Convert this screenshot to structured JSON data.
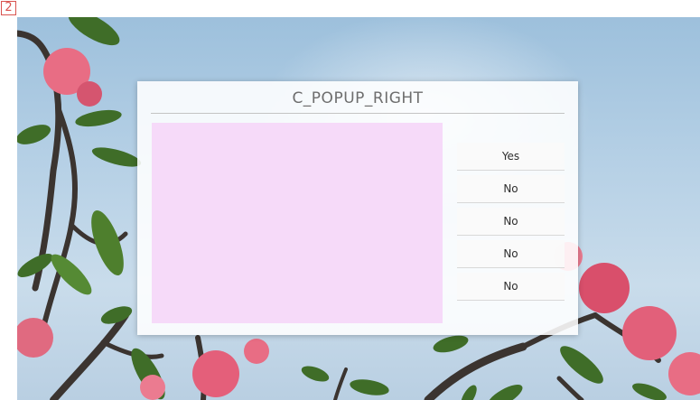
{
  "page_marker": "2",
  "popup": {
    "title": "C_POPUP_RIGHT",
    "buttons": [
      {
        "label": "Yes"
      },
      {
        "label": "No"
      },
      {
        "label": "No"
      },
      {
        "label": "No"
      },
      {
        "label": "No"
      }
    ]
  },
  "colors": {
    "sky": "#b7d1e6",
    "content_area": "#f5d7f8",
    "flower": "#e2607a",
    "leaf": "#3f6d28"
  }
}
